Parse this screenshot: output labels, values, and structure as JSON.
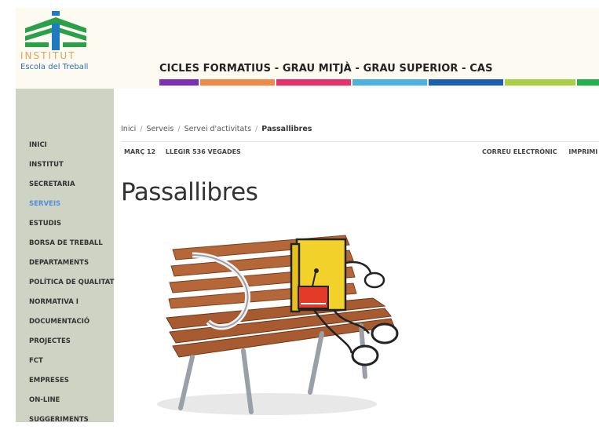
{
  "header": {
    "logo_line1": "INSTITUT",
    "logo_line2": "Escola del Treball",
    "title": "CICLES FORMATIUS - GRAU MITJÀ - GRAU SUPERIOR - CAS",
    "color_bar": [
      "#7b2fb5",
      "#f08a4b",
      "#e8306f",
      "#4cb2e0",
      "#1a5fb4",
      "#a8cf45",
      "#22b14c"
    ]
  },
  "sidebar": {
    "items": [
      {
        "label": "INICI"
      },
      {
        "label": "INSTITUT"
      },
      {
        "label": "SECRETARIA"
      },
      {
        "label": "SERVEIS"
      },
      {
        "label": "ESTUDIS"
      },
      {
        "label": "BORSA DE TREBALL"
      },
      {
        "label": "DEPARTAMENTS"
      },
      {
        "label": "POLÍTICA DE QUALITAT"
      },
      {
        "label": "NORMATIVA I"
      },
      {
        "label": "DOCUMENTACIÓ"
      },
      {
        "label": "PROJECTES"
      },
      {
        "label": "FCT"
      },
      {
        "label": "EMPRESES"
      },
      {
        "label": "ON-LINE"
      },
      {
        "label": "SUGGERIMENTS"
      }
    ],
    "active_index": 3,
    "active_color": "#4f8fd6"
  },
  "breadcrumb": {
    "items": [
      "Inici",
      "Serveis",
      "Servei d'activitats"
    ],
    "current": "Passallibres",
    "separator": "/"
  },
  "meta": {
    "date": "MARÇ 12",
    "reads": "LLEGIR 536 VEGADES",
    "email": "CORREU ELECTRÒNIC",
    "print": "IMPRIMI"
  },
  "article": {
    "title": "Passallibres"
  }
}
